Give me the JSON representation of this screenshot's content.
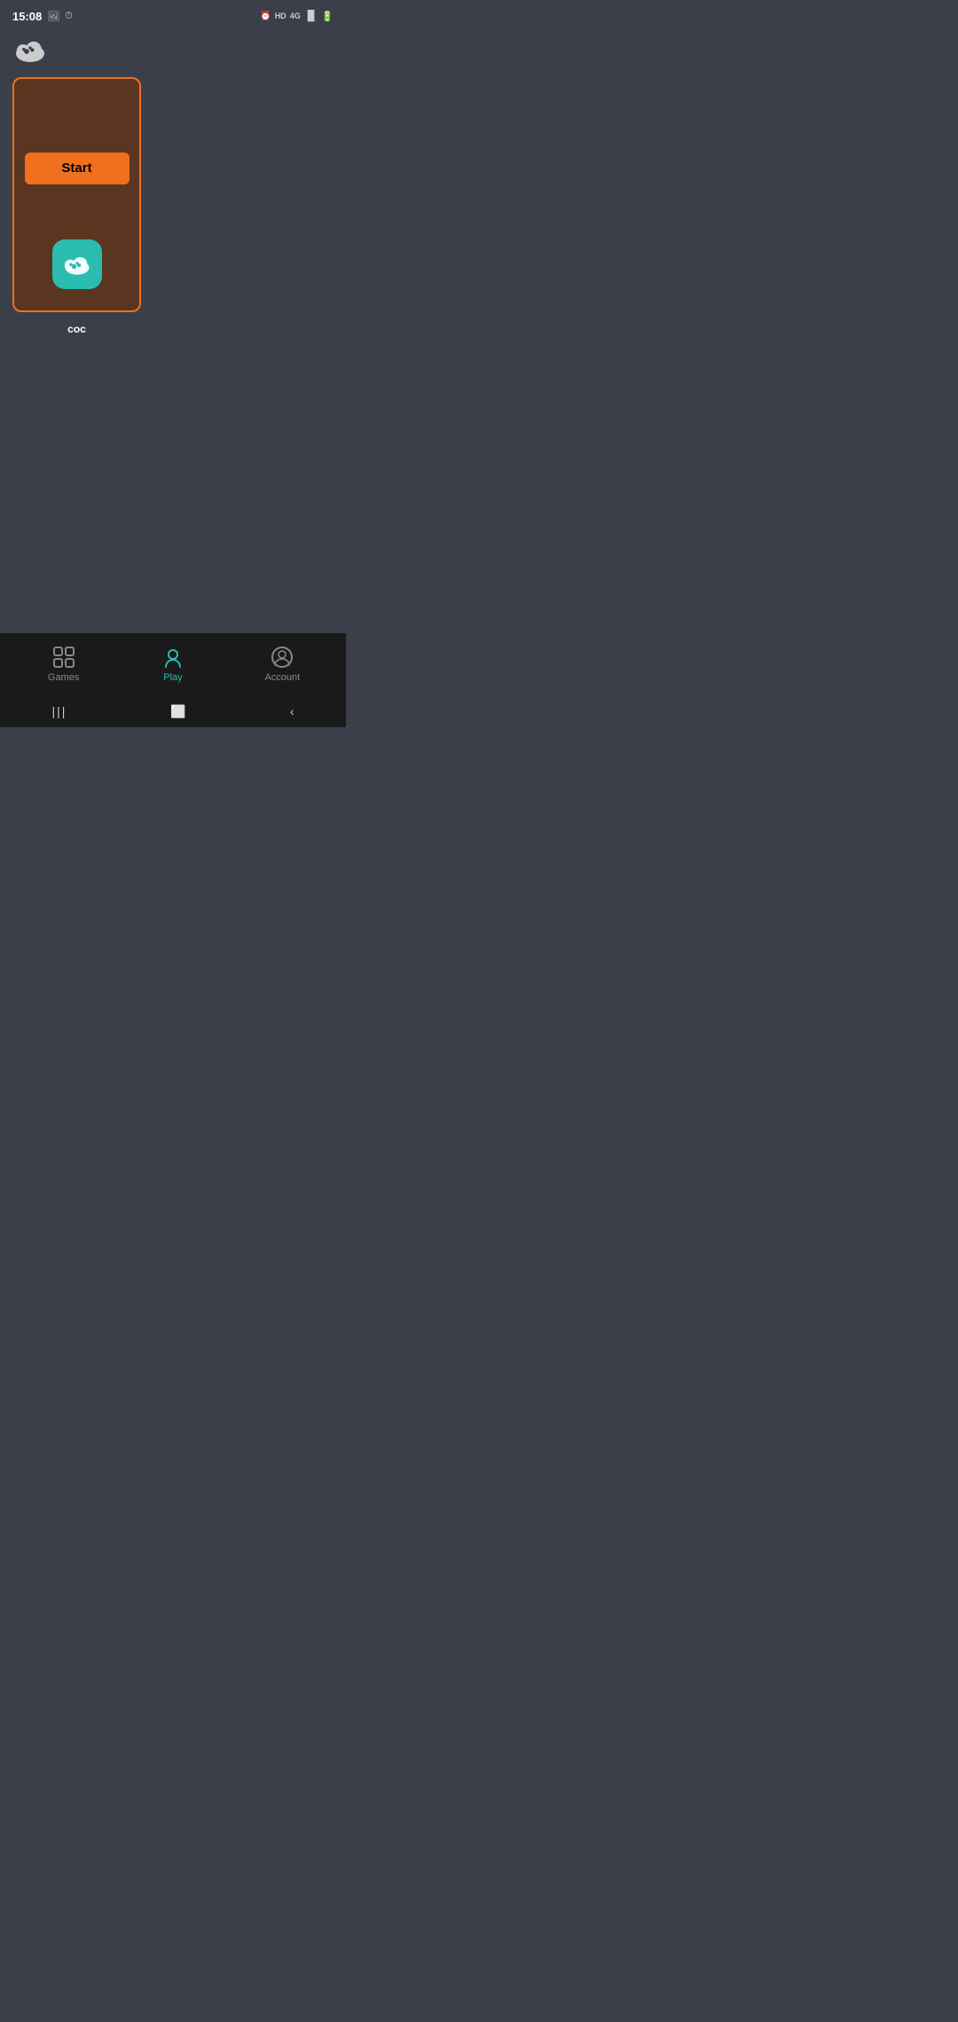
{
  "statusBar": {
    "time": "15:08",
    "rightIcons": [
      "⏰",
      "HD",
      "4G",
      "📶",
      "🔋"
    ]
  },
  "header": {
    "logoAlt": "paw-cloud-logo"
  },
  "gameCard": {
    "startButtonLabel": "Start",
    "appName": "coc"
  },
  "bottomNav": {
    "items": [
      {
        "id": "games",
        "label": "Games",
        "active": false
      },
      {
        "id": "play",
        "label": "Play",
        "active": true
      },
      {
        "id": "account",
        "label": "Account",
        "active": false
      }
    ]
  },
  "colors": {
    "accent": "#f07020",
    "teal": "#2abcb0",
    "cardBg": "#5a3520",
    "screenBg": "#3a3f4a",
    "navBg": "#1a1a1a"
  }
}
